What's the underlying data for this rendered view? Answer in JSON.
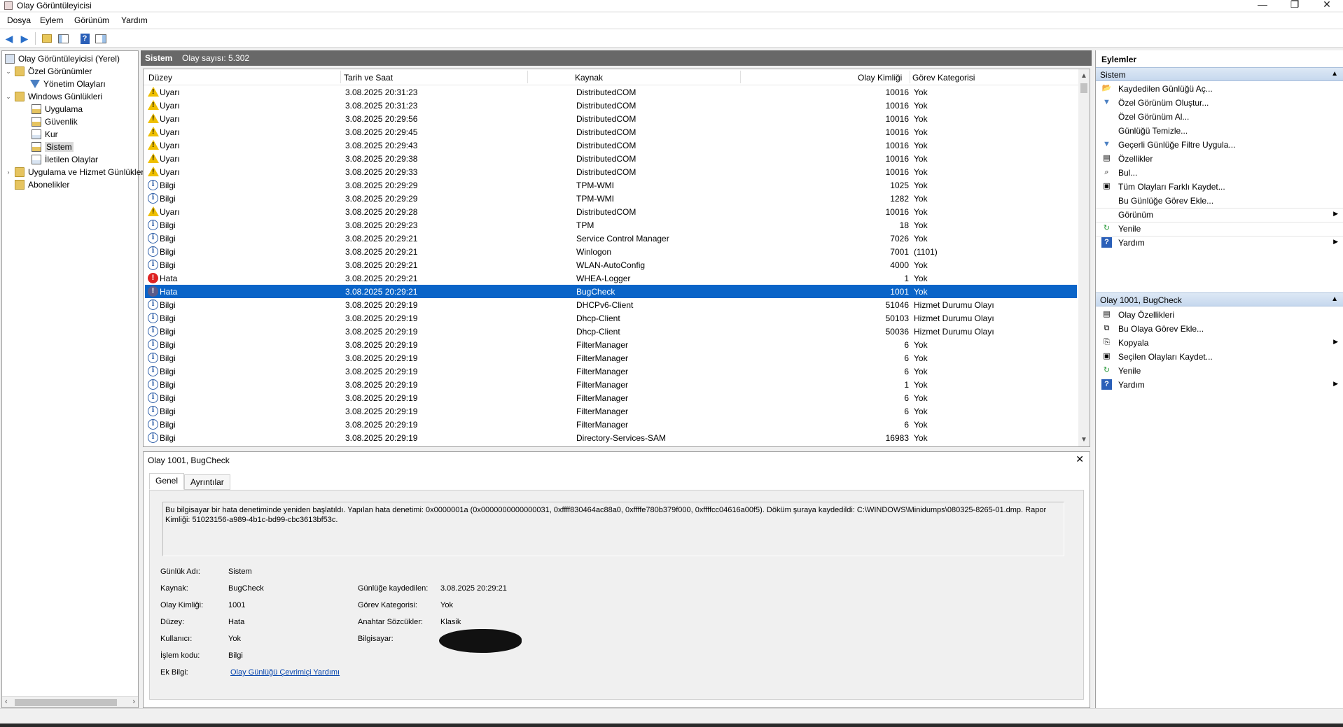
{
  "window": {
    "title": "Olay Görüntüleyicisi",
    "minimize": "—",
    "restore": "❐",
    "close": "✕"
  },
  "menu": [
    "Dosya",
    "Eylem",
    "Görünüm",
    "Yardım"
  ],
  "toolbar": {
    "back_icon": "arrow-left-icon",
    "forward_icon": "arrow-right-icon",
    "help_glyph": "?"
  },
  "tree": {
    "nodes": [
      {
        "label": "Olay Görüntüleyicisi (Yerel)",
        "icon": "computer-icon"
      },
      {
        "label": "Özel Görünümler",
        "icon": "folder-icon",
        "expander": "⌄"
      },
      {
        "label": "Yönetim Olayları",
        "icon": "filter-icon"
      },
      {
        "label": "Windows Günlükleri",
        "icon": "folder-icon",
        "expander": "⌄"
      },
      {
        "label": "Uygulama",
        "icon": "log-icon"
      },
      {
        "label": "Güvenlik",
        "icon": "log-icon"
      },
      {
        "label": "Kur",
        "icon": "log-icon"
      },
      {
        "label": "Sistem",
        "icon": "log-icon",
        "selected": true
      },
      {
        "label": "İletilen Olaylar",
        "icon": "log-icon"
      },
      {
        "label": "Uygulama ve Hizmet Günlükleri",
        "icon": "folder-icon",
        "expander": "›"
      },
      {
        "label": "Abonelikler",
        "icon": "subscription-icon"
      }
    ],
    "scroll_left": "‹",
    "scroll_right": "›"
  },
  "center": {
    "log_name": "Sistem",
    "count_text": "Olay sayısı: 5.302"
  },
  "event_columns": [
    "Düzey",
    "Tarih ve Saat",
    "Kaynak",
    "Olay Kimliği",
    "Görev Kategorisi"
  ],
  "events": [
    {
      "level": "Uyarı",
      "type": "warn",
      "date": "3.08.2025 20:31:23",
      "source": "DistributedCOM",
      "id": "10016",
      "category": "Yok"
    },
    {
      "level": "Uyarı",
      "type": "warn",
      "date": "3.08.2025 20:31:23",
      "source": "DistributedCOM",
      "id": "10016",
      "category": "Yok"
    },
    {
      "level": "Uyarı",
      "type": "warn",
      "date": "3.08.2025 20:29:56",
      "source": "DistributedCOM",
      "id": "10016",
      "category": "Yok"
    },
    {
      "level": "Uyarı",
      "type": "warn",
      "date": "3.08.2025 20:29:45",
      "source": "DistributedCOM",
      "id": "10016",
      "category": "Yok"
    },
    {
      "level": "Uyarı",
      "type": "warn",
      "date": "3.08.2025 20:29:43",
      "source": "DistributedCOM",
      "id": "10016",
      "category": "Yok"
    },
    {
      "level": "Uyarı",
      "type": "warn",
      "date": "3.08.2025 20:29:38",
      "source": "DistributedCOM",
      "id": "10016",
      "category": "Yok"
    },
    {
      "level": "Uyarı",
      "type": "warn",
      "date": "3.08.2025 20:29:33",
      "source": "DistributedCOM",
      "id": "10016",
      "category": "Yok"
    },
    {
      "level": "Bilgi",
      "type": "info",
      "date": "3.08.2025 20:29:29",
      "source": "TPM-WMI",
      "id": "1025",
      "category": "Yok"
    },
    {
      "level": "Bilgi",
      "type": "info",
      "date": "3.08.2025 20:29:29",
      "source": "TPM-WMI",
      "id": "1282",
      "category": "Yok"
    },
    {
      "level": "Uyarı",
      "type": "warn",
      "date": "3.08.2025 20:29:28",
      "source": "DistributedCOM",
      "id": "10016",
      "category": "Yok"
    },
    {
      "level": "Bilgi",
      "type": "info",
      "date": "3.08.2025 20:29:23",
      "source": "TPM",
      "id": "18",
      "category": "Yok"
    },
    {
      "level": "Bilgi",
      "type": "info",
      "date": "3.08.2025 20:29:21",
      "source": "Service Control Manager",
      "id": "7026",
      "category": "Yok"
    },
    {
      "level": "Bilgi",
      "type": "info",
      "date": "3.08.2025 20:29:21",
      "source": "Winlogon",
      "id": "7001",
      "category": "(1101)"
    },
    {
      "level": "Bilgi",
      "type": "info",
      "date": "3.08.2025 20:29:21",
      "source": "WLAN-AutoConfig",
      "id": "4000",
      "category": "Yok"
    },
    {
      "level": "Hata",
      "type": "err",
      "date": "3.08.2025 20:29:21",
      "source": "WHEA-Logger",
      "id": "1",
      "category": "Yok"
    },
    {
      "level": "Hata",
      "type": "err",
      "date": "3.08.2025 20:29:21",
      "source": "BugCheck",
      "id": "1001",
      "category": "Yok",
      "selected": true
    },
    {
      "level": "Bilgi",
      "type": "info",
      "date": "3.08.2025 20:29:19",
      "source": "DHCPv6-Client",
      "id": "51046",
      "category": "Hizmet Durumu Olayı"
    },
    {
      "level": "Bilgi",
      "type": "info",
      "date": "3.08.2025 20:29:19",
      "source": "Dhcp-Client",
      "id": "50103",
      "category": "Hizmet Durumu Olayı"
    },
    {
      "level": "Bilgi",
      "type": "info",
      "date": "3.08.2025 20:29:19",
      "source": "Dhcp-Client",
      "id": "50036",
      "category": "Hizmet Durumu Olayı"
    },
    {
      "level": "Bilgi",
      "type": "info",
      "date": "3.08.2025 20:29:19",
      "source": "FilterManager",
      "id": "6",
      "category": "Yok"
    },
    {
      "level": "Bilgi",
      "type": "info",
      "date": "3.08.2025 20:29:19",
      "source": "FilterManager",
      "id": "6",
      "category": "Yok"
    },
    {
      "level": "Bilgi",
      "type": "info",
      "date": "3.08.2025 20:29:19",
      "source": "FilterManager",
      "id": "6",
      "category": "Yok"
    },
    {
      "level": "Bilgi",
      "type": "info",
      "date": "3.08.2025 20:29:19",
      "source": "FilterManager",
      "id": "1",
      "category": "Yok"
    },
    {
      "level": "Bilgi",
      "type": "info",
      "date": "3.08.2025 20:29:19",
      "source": "FilterManager",
      "id": "6",
      "category": "Yok"
    },
    {
      "level": "Bilgi",
      "type": "info",
      "date": "3.08.2025 20:29:19",
      "source": "FilterManager",
      "id": "6",
      "category": "Yok"
    },
    {
      "level": "Bilgi",
      "type": "info",
      "date": "3.08.2025 20:29:19",
      "source": "FilterManager",
      "id": "6",
      "category": "Yok"
    },
    {
      "level": "Bilgi",
      "type": "info",
      "date": "3.08.2025 20:29:19",
      "source": "Directory-Services-SAM",
      "id": "16983",
      "category": "Yok"
    }
  ],
  "detail": {
    "title": "Olay 1001, BugCheck",
    "close": "✕",
    "tabs": [
      "Genel",
      "Ayrıntılar"
    ],
    "message": "Bu bilgisayar bir hata denetiminde yeniden başlatıldı. Yapılan hata denetimi: 0x0000001a (0x0000000000000031, 0xffff830464ac88a0, 0xffffe780b379f000, 0xffffcc04616a00f5). Döküm şuraya kaydedildi: C:\\WINDOWS\\Minidumps\\080325-8265-01.dmp. Rapor Kimliği: 51023156-a989-4b1c-bd99-cbc3613bf53c.",
    "fields_left": [
      {
        "label": "Günlük Adı:",
        "value": "Sistem"
      },
      {
        "label": "Kaynak:",
        "value": "BugCheck"
      },
      {
        "label": "Olay Kimliği:",
        "value": "1001"
      },
      {
        "label": "Düzey:",
        "value": "Hata"
      },
      {
        "label": "Kullanıcı:",
        "value": "Yok"
      },
      {
        "label": "İşlem kodu:",
        "value": "Bilgi"
      },
      {
        "label": "Ek Bilgi:",
        "value": "Olay Günlüğü Çevrimiçi Yardımı"
      }
    ],
    "fields_right": [
      {
        "label": "Günlüğe kaydedilen:",
        "value": "3.08.2025 20:29:21"
      },
      {
        "label": "Görev Kategorisi:",
        "value": "Yok"
      },
      {
        "label": "Anahtar Sözcükler:",
        "value": "Klasik"
      },
      {
        "label": "Bilgisayar:",
        "value": ""
      }
    ]
  },
  "actions": {
    "title": "Eylemler",
    "section1": "Sistem",
    "items1": [
      {
        "label": "Kaydedilen Günlüğü Aç...",
        "icon": "open-log-icon"
      },
      {
        "label": "Özel Görünüm Oluştur...",
        "icon": "filter-icon"
      },
      {
        "label": "Özel Görünüm Al...",
        "icon": ""
      },
      {
        "label": "Günlüğü Temizle...",
        "icon": ""
      },
      {
        "label": "Geçerli Günlüğe Filtre Uygula...",
        "icon": "filter-icon"
      },
      {
        "label": "Özellikler",
        "icon": "properties-icon"
      },
      {
        "label": "Bul...",
        "icon": "binoculars-icon"
      },
      {
        "label": "Tüm Olayları Farklı Kaydet...",
        "icon": "save-icon"
      },
      {
        "label": "Bu Günlüğe Görev Ekle...",
        "icon": ""
      },
      {
        "label": "Görünüm",
        "icon": "",
        "submenu": true
      },
      {
        "label": "Yenile",
        "icon": "refresh-icon"
      },
      {
        "label": "Yardım",
        "icon": "help-icon",
        "submenu": true
      }
    ],
    "section2": "Olay 1001, BugCheck",
    "items2": [
      {
        "label": "Olay Özellikleri",
        "icon": "event-properties-icon"
      },
      {
        "label": "Bu Olaya Görev Ekle...",
        "icon": "task-icon"
      },
      {
        "label": "Kopyala",
        "icon": "copy-icon",
        "submenu": true
      },
      {
        "label": "Seçilen Olayları Kaydet...",
        "icon": "save-icon"
      },
      {
        "label": "Yenile",
        "icon": "refresh-icon"
      },
      {
        "label": "Yardım",
        "icon": "help-icon",
        "submenu": true
      }
    ],
    "collapse_caret": "▲",
    "submenu_arrow": "▶"
  },
  "colors": {
    "selection": "#0a64c8",
    "header_bar": "#686868",
    "section_bg": "#c6d8ee",
    "link": "#0645ad"
  }
}
